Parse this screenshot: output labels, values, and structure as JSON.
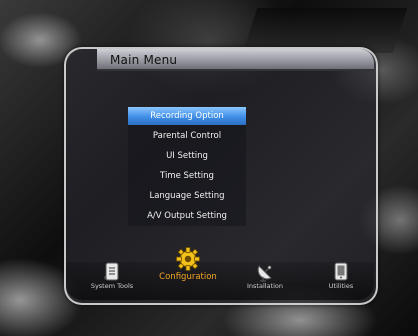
{
  "window": {
    "title": "Main Menu"
  },
  "menu": {
    "items": [
      {
        "label": "Recording Option",
        "selected": true
      },
      {
        "label": "Parental Control",
        "selected": false
      },
      {
        "label": "UI Setting",
        "selected": false
      },
      {
        "label": "Time Setting",
        "selected": false
      },
      {
        "label": "Language Setting",
        "selected": false
      },
      {
        "label": "A/V Output Setting",
        "selected": false
      }
    ]
  },
  "dock": {
    "items": [
      {
        "label": "System Tools",
        "icon": "document-icon",
        "active": false
      },
      {
        "label": "Configuration",
        "icon": "gear-icon",
        "active": true
      },
      {
        "label": "Installation",
        "icon": "satellite-dish-icon",
        "active": false
      },
      {
        "label": "Utilities",
        "icon": "device-icon",
        "active": false
      }
    ]
  },
  "colors": {
    "selection": "#3f8ee6",
    "active_label": "#f5a623",
    "panel_border": "#e6e6e6"
  }
}
